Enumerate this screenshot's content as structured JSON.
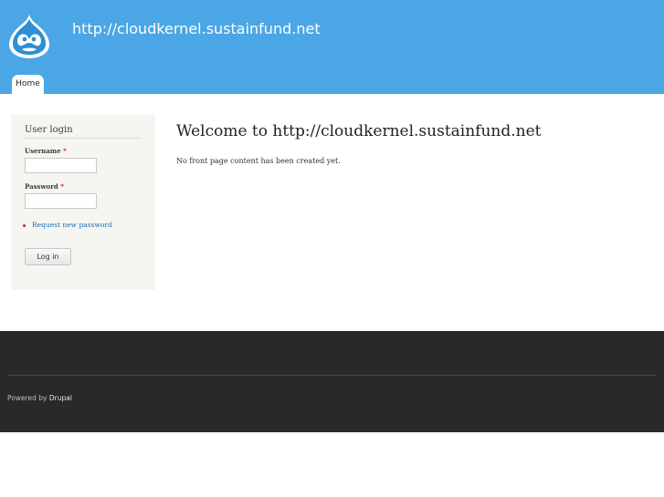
{
  "header": {
    "site_name": "http://cloudkernel.sustainfund.net",
    "logo_icon": "drupal-drop-icon",
    "background_color": "#4aa6e5"
  },
  "tabs": [
    {
      "label": "Home",
      "active": true
    }
  ],
  "sidebar": {
    "block_title": "User login",
    "username_label": "Username",
    "password_label": "Password",
    "required_marker": "*",
    "username_value": "",
    "password_value": "",
    "request_password_link": "Request new password",
    "login_button": "Log in"
  },
  "main": {
    "title": "Welcome to http://cloudkernel.sustainfund.net",
    "text": "No front page content has been created yet."
  },
  "footer": {
    "powered_by": "Powered by",
    "drupal_link": "Drupal",
    "background_color": "#292929"
  }
}
